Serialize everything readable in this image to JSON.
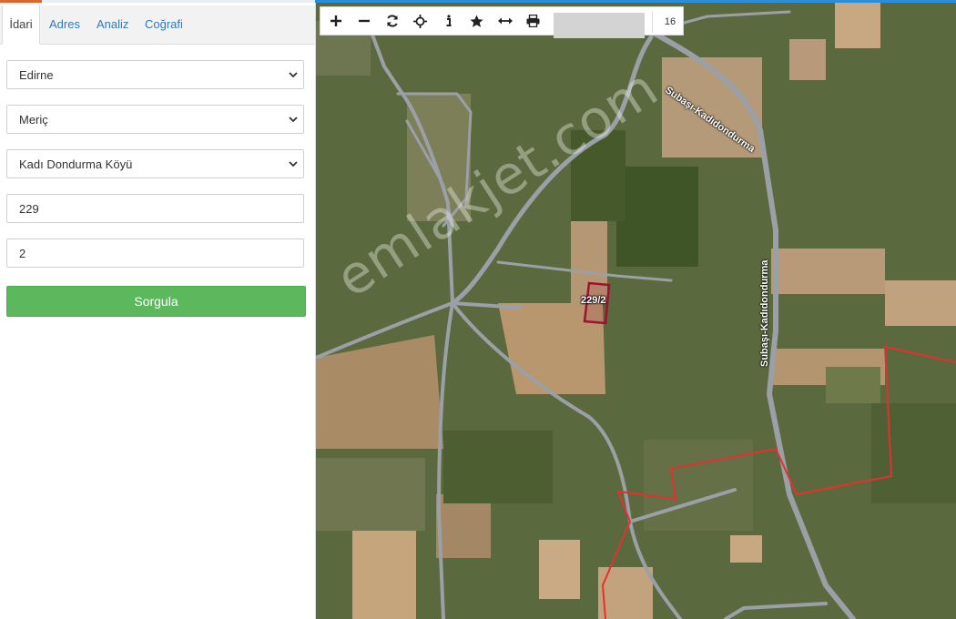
{
  "tabs": [
    {
      "label": "İdari",
      "active": true
    },
    {
      "label": "Adres",
      "active": false
    },
    {
      "label": "Analiz",
      "active": false
    },
    {
      "label": "Coğrafi",
      "active": false
    }
  ],
  "form": {
    "province": "Edirne",
    "district": "Meriç",
    "neighborhood": "Kadı Dondurma Köyü",
    "block_no": "229",
    "parcel_no": "2",
    "submit_label": "Sorgula"
  },
  "map": {
    "toolbar": {
      "icons": [
        "zoom-in-icon",
        "zoom-out-icon",
        "refresh-icon",
        "locate-icon",
        "info-icon",
        "star-icon",
        "measure-icon",
        "print-icon"
      ],
      "search_value": "",
      "zoom_level": "16"
    },
    "road_labels": [
      "Subaşı-Kadıdondurma",
      "Subaşı-Kadıdondurma"
    ],
    "parcel_label": "229/2",
    "watermark": "emlakjet.com",
    "colors": {
      "parcel_outline": "#a01030",
      "boundary": "#e53030",
      "road": "#9aa0a6",
      "query_button": "#5cb85c",
      "link": "#2f7bbf"
    }
  }
}
